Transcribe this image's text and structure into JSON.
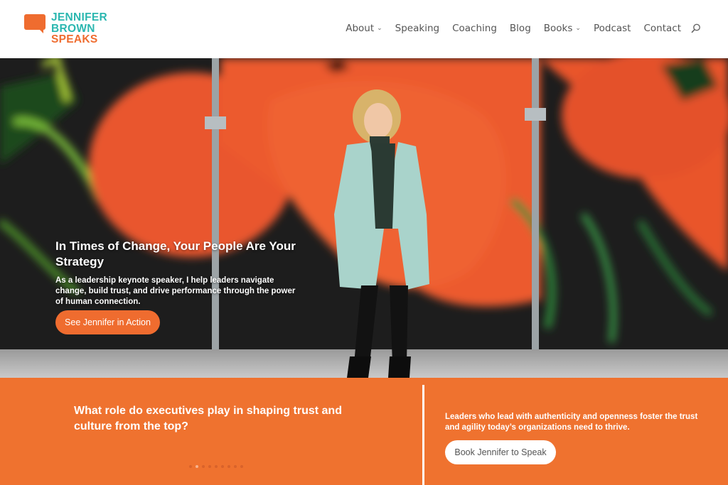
{
  "brand": {
    "line1": "JENNIFER",
    "line2": "BROWN",
    "line3": "SPEAKS",
    "teal": "#2bb7b0",
    "orange": "#ef6c2f"
  },
  "nav": {
    "items": [
      {
        "label": "About",
        "has_dropdown": true
      },
      {
        "label": "Speaking",
        "has_dropdown": false
      },
      {
        "label": "Coaching",
        "has_dropdown": false
      },
      {
        "label": "Blog",
        "has_dropdown": false
      },
      {
        "label": "Books",
        "has_dropdown": true
      },
      {
        "label": "Podcast",
        "has_dropdown": false
      },
      {
        "label": "Contact",
        "has_dropdown": false
      }
    ],
    "dropdown_glyph": "⌄",
    "search_icon": "search-icon"
  },
  "hero": {
    "title": "In Times of Change, Your People Are Your Strategy",
    "body": "As a leadership keynote speaker, I help leaders navigate change, build trust, and drive performance through the power of human connection.",
    "button_label": "See Jennifer in Action"
  },
  "band": {
    "question": "What role do executives play in shaping trust and culture from the top?",
    "right_text": "Leaders who lead with authenticity and openness foster the trust and agility today’s organizations need to thrive.",
    "button_label": "Book Jennifer to Speak",
    "slider_dot_count": 9,
    "slider_active_index": 1,
    "accent": "#ef722f"
  }
}
